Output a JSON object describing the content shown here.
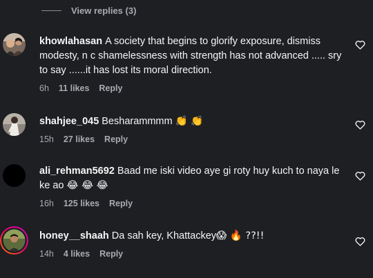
{
  "view_replies": {
    "label": "View replies (3)"
  },
  "comments": [
    {
      "username": "khowlahasan",
      "text": "A society that begins to glorify exposure, dismiss modesty, n c shamelessness with strength has not advanced ..... sry to say ......it has lost its moral direction.",
      "time": "6h",
      "likes": "11 likes",
      "reply": "Reply"
    },
    {
      "username": "shahjee_045",
      "text": "Besharammmm",
      "emojis": "👏 👏",
      "time": "15h",
      "likes": "27 likes",
      "reply": "Reply"
    },
    {
      "username": "ali_rehman5692",
      "text": "Baad me iski video aye gi roty huy kuch to naya le ke ao",
      "emojis": "😂 😂 😂",
      "time": "16h",
      "likes": "125 likes",
      "reply": "Reply"
    },
    {
      "username": "honey__shaah",
      "text": "Da sah key, Khattackey",
      "emojis": "😱  🔥 ??!!",
      "time": "14h",
      "likes": "4 likes",
      "reply": "Reply"
    }
  ],
  "icons": {
    "heart": "heart-outline-icon"
  },
  "colors": {
    "background": "#1e1f23",
    "text_primary": "#f5f5f5",
    "text_secondary": "#a8abb1",
    "story_ring": "#d300c5"
  }
}
